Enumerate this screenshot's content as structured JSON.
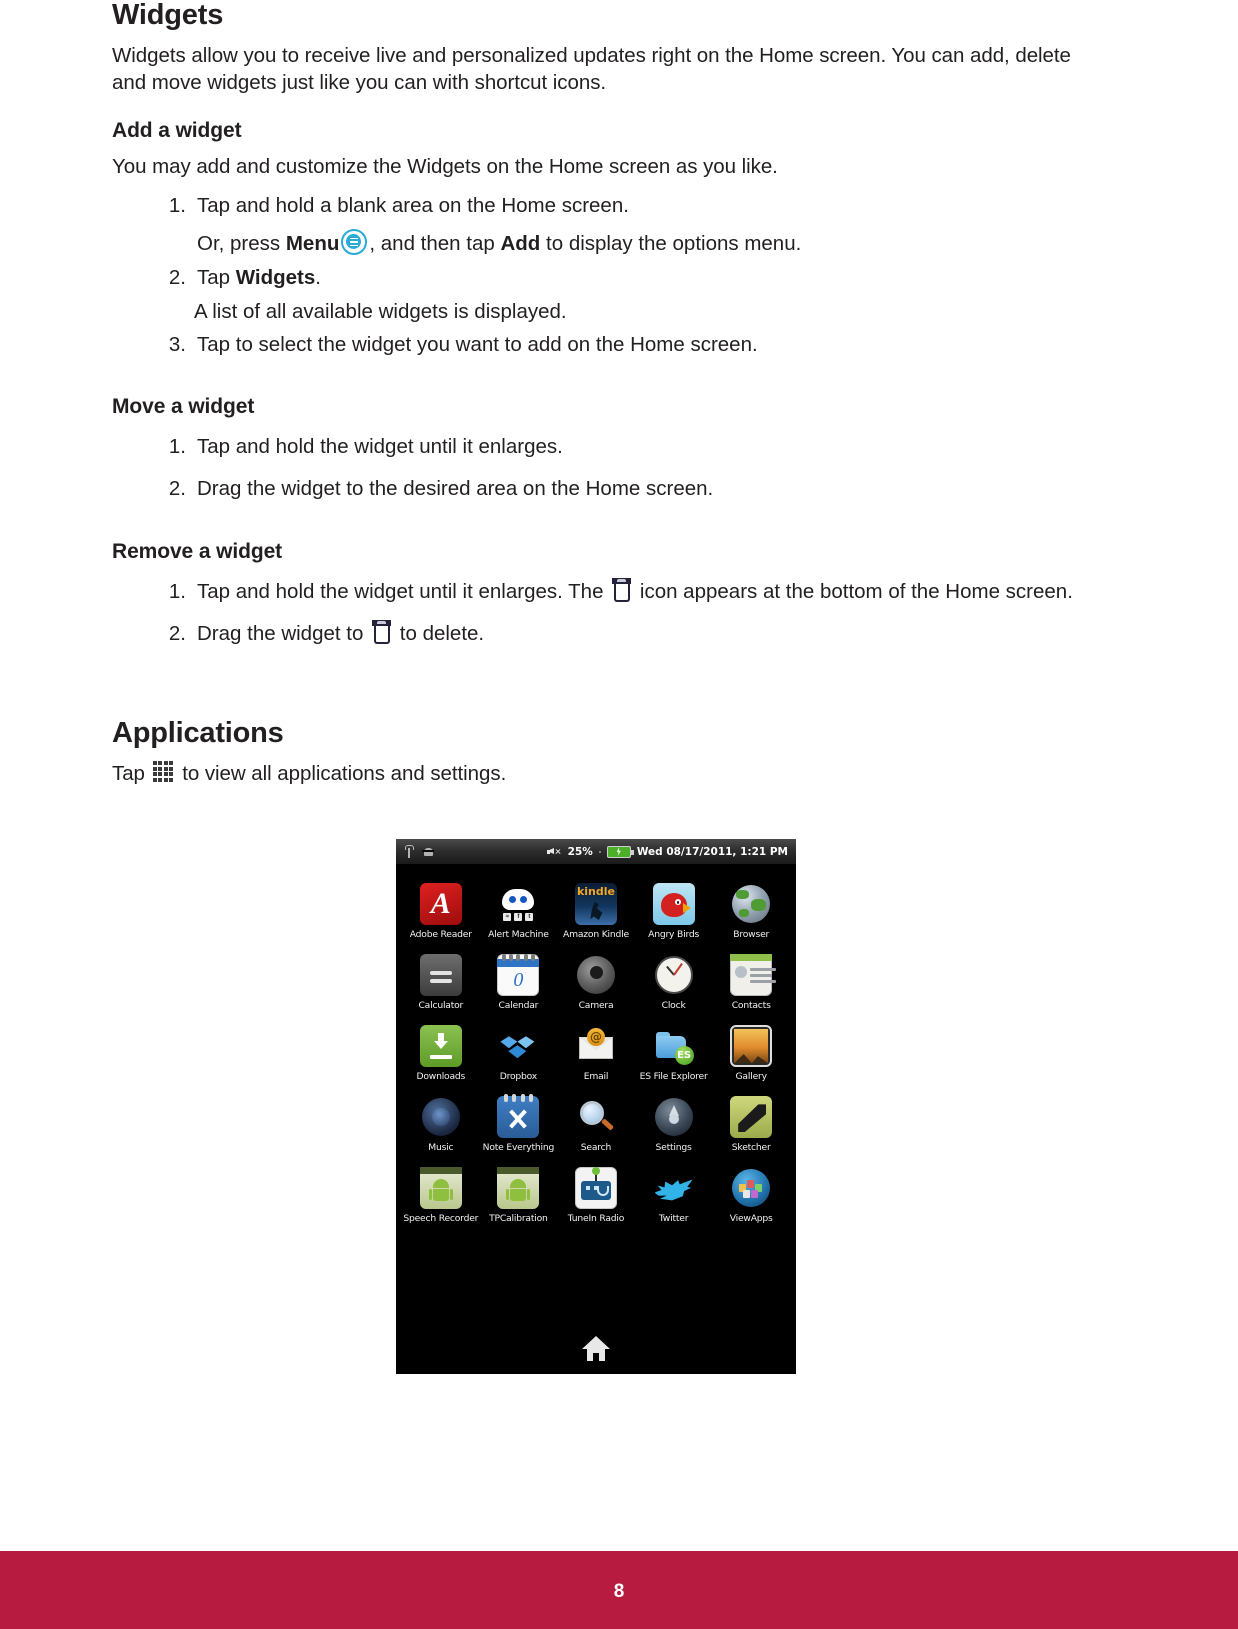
{
  "document": {
    "page_number": "8",
    "footer_color": "#b81b40"
  },
  "sections": {
    "widgets": {
      "title": "Widgets",
      "intro": "Widgets allow you to receive live and personalized updates right on the Home screen. You can add, delete and move widgets just like you can with shortcut icons.",
      "add": {
        "title": "Add a widget",
        "intro": "You may add and customize the Widgets on the Home screen as you like.",
        "step1_num": "1.",
        "step1": "Tap and hold a blank area on the Home screen.",
        "step1_sub_a": "Or, press ",
        "step1_sub_menu": "Menu",
        "step1_sub_b": ", and then tap ",
        "step1_sub_add": "Add",
        "step1_sub_c": " to display the options menu.",
        "step2_num": "2.",
        "step2_a": "Tap ",
        "step2_bold": "Widgets",
        "step2_b": ".",
        "step2_sub": "A list of all available widgets is displayed.",
        "step3_num": "3.",
        "step3": "Tap to select the widget you want to add on the Home screen."
      },
      "move": {
        "title": "Move a widget",
        "step1_num": "1.",
        "step1": "Tap and hold the widget until it enlarges.",
        "step2_num": "2.",
        "step2": "Drag the widget to the desired area on the Home screen."
      },
      "remove": {
        "title": "Remove a widget",
        "step1_num": "1.",
        "step1_a": "Tap and hold the widget until it enlarges. The ",
        "step1_b": " icon appears at the bottom of the Home screen.",
        "step2_num": "2.",
        "step2_a": "Drag the widget to ",
        "step2_b": " to delete."
      }
    },
    "applications": {
      "title": "Applications",
      "intro_a": "Tap ",
      "intro_b": " to view all applications and settings."
    }
  },
  "tablet": {
    "statusbar": {
      "usb_icon": "usb-icon",
      "android_icon": "android-icon",
      "mute_icon": "mute-icon",
      "battery_percent": "25%",
      "battery_icon": "battery-charging-icon",
      "datetime": "Wed 08/17/2011, 1:21 PM"
    },
    "apps": [
      {
        "label": "Adobe Reader",
        "icon": "adobe-reader-icon"
      },
      {
        "label": "Alert Machine",
        "icon": "alert-machine-icon"
      },
      {
        "label": "Amazon Kindle",
        "icon": "amazon-kindle-icon"
      },
      {
        "label": "Angry Birds",
        "icon": "angry-birds-icon"
      },
      {
        "label": "Browser",
        "icon": "browser-icon"
      },
      {
        "label": "Calculator",
        "icon": "calculator-icon"
      },
      {
        "label": "Calendar",
        "icon": "calendar-icon"
      },
      {
        "label": "Camera",
        "icon": "camera-icon"
      },
      {
        "label": "Clock",
        "icon": "clock-icon"
      },
      {
        "label": "Contacts",
        "icon": "contacts-icon"
      },
      {
        "label": "Downloads",
        "icon": "downloads-icon"
      },
      {
        "label": "Dropbox",
        "icon": "dropbox-icon"
      },
      {
        "label": "Email",
        "icon": "email-icon"
      },
      {
        "label": "ES File Explorer",
        "icon": "es-file-explorer-icon"
      },
      {
        "label": "Gallery",
        "icon": "gallery-icon"
      },
      {
        "label": "Music",
        "icon": "music-icon"
      },
      {
        "label": "Note Everything",
        "icon": "note-everything-icon"
      },
      {
        "label": "Search",
        "icon": "search-icon"
      },
      {
        "label": "Settings",
        "icon": "settings-icon"
      },
      {
        "label": "Sketcher",
        "icon": "sketcher-icon"
      },
      {
        "label": "Speech Recorder",
        "icon": "speech-recorder-icon"
      },
      {
        "label": "TPCalibration",
        "icon": "tp-calibration-icon"
      },
      {
        "label": "TuneIn Radio",
        "icon": "tunein-radio-icon"
      },
      {
        "label": "Twitter",
        "icon": "twitter-icon"
      },
      {
        "label": "ViewApps",
        "icon": "viewapps-icon"
      }
    ],
    "home_button_icon": "home-icon"
  }
}
